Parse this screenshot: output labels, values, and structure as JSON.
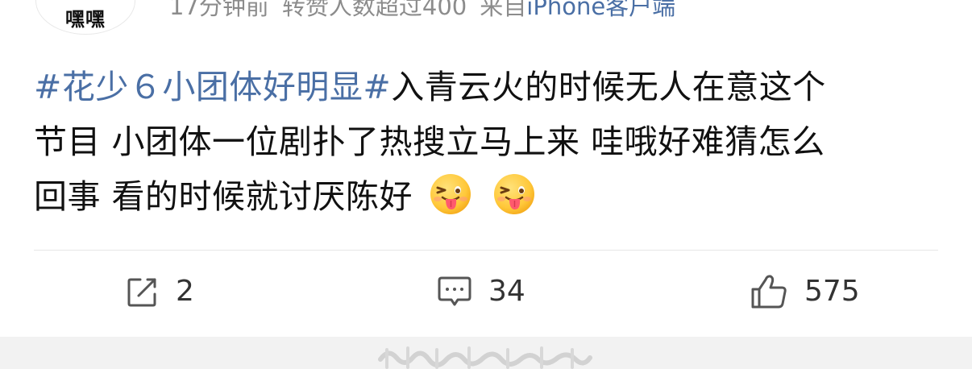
{
  "header": {
    "avatar_text": "嘿嘿",
    "time": "17分钟前",
    "repost_note": "转赞人数超过400",
    "from_prefix": "来自",
    "from_device": "iPhone客户端"
  },
  "post": {
    "hashtag": "#花少６小团体好明显#",
    "text_line1": "入青云火的时候无人在意这个",
    "text_line2": "节目 小团体一位剧扑了热搜立马上来 哇哦好难猜怎么",
    "text_line3": "回事 看的时候就讨厌陈好",
    "emojis": [
      "tongue-out-emoji",
      "tongue-out-emoji"
    ]
  },
  "actions": {
    "repost": {
      "icon": "edit-share-icon",
      "count": "2"
    },
    "comment": {
      "icon": "comment-icon",
      "count": "34"
    },
    "like": {
      "icon": "thumbs-up-icon",
      "count": "575"
    }
  },
  "colors": {
    "hashtag": "#4a6fa5",
    "meta": "#8c8c8c",
    "text": "#111111",
    "bottom_bar": "#f2f2f2"
  }
}
